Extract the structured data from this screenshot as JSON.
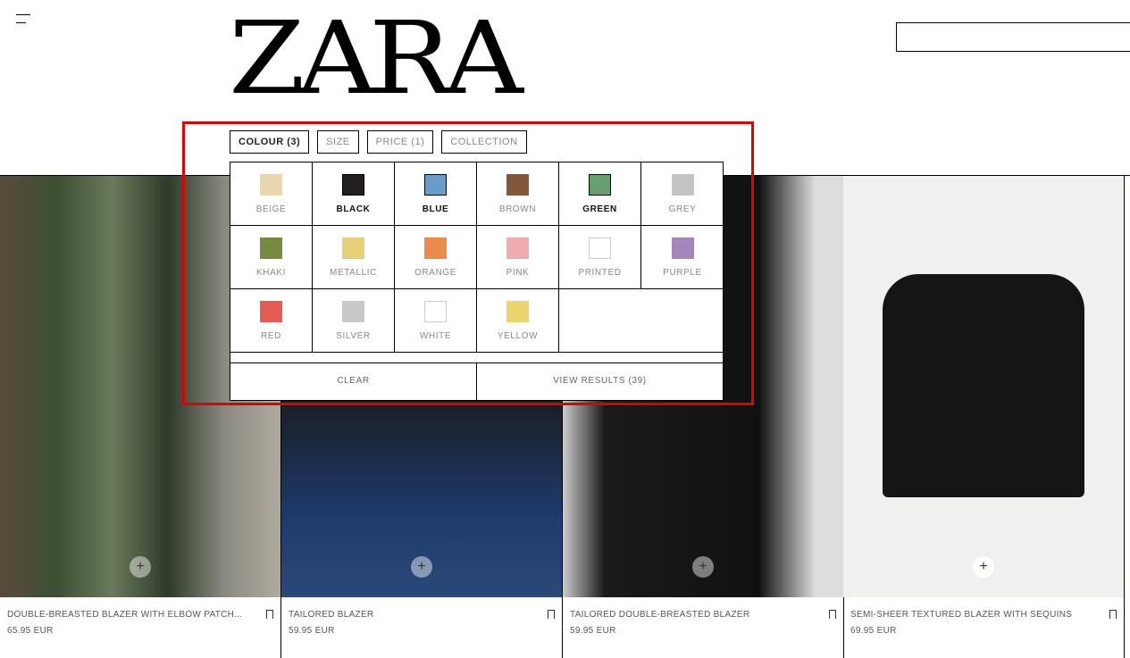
{
  "brand": "ZARA",
  "filters": {
    "tabs": [
      {
        "label": "COLOUR (3)",
        "active": true
      },
      {
        "label": "SIZE"
      },
      {
        "label": "PRICE (1)"
      },
      {
        "label": "COLLECTION"
      }
    ],
    "colours": [
      {
        "label": "BEIGE",
        "hex": "#e8d7ae",
        "selected": false
      },
      {
        "label": "BLACK",
        "hex": "#231f20",
        "selected": true
      },
      {
        "label": "BLUE",
        "hex": "#6a9cc9",
        "selected": true
      },
      {
        "label": "BROWN",
        "hex": "#83583a",
        "selected": false
      },
      {
        "label": "GREEN",
        "hex": "#66a06c",
        "selected": true
      },
      {
        "label": "GREY",
        "hex": "#c4c4c4",
        "selected": false
      },
      {
        "label": "KHAKI",
        "hex": "#768b3f",
        "selected": false
      },
      {
        "label": "METALLIC",
        "hex": "#e8cf76",
        "selected": false
      },
      {
        "label": "ORANGE",
        "hex": "#ec8a4c",
        "selected": false
      },
      {
        "label": "PINK",
        "hex": "#efabad",
        "selected": false
      },
      {
        "label": "PRINTED",
        "hex": "#ffffff",
        "selected": false
      },
      {
        "label": "PURPLE",
        "hex": "#a486bb",
        "selected": false
      },
      {
        "label": "RED",
        "hex": "#e45d50",
        "selected": false
      },
      {
        "label": "SILVER",
        "hex": "#c8c8c8",
        "selected": false
      },
      {
        "label": "WHITE",
        "hex": "#ffffff",
        "selected": false
      },
      {
        "label": "YELLOW",
        "hex": "#ebd46a",
        "selected": false
      }
    ],
    "clear": "CLEAR",
    "view_results": "VIEW RESULTS (39)"
  },
  "products": [
    {
      "name": "DOUBLE-BREASTED BLAZER WITH ELBOW PATCH...",
      "price": "65.95 EUR"
    },
    {
      "name": "TAILORED BLAZER",
      "price": "59.95 EUR"
    },
    {
      "name": "TAILORED DOUBLE-BREASTED BLAZER",
      "price": "59.95 EUR"
    },
    {
      "name": "SEMI-SHEER TEXTURED BLAZER WITH SEQUINS",
      "price": "69.95 EUR"
    }
  ],
  "highlight_color": "#e00000"
}
